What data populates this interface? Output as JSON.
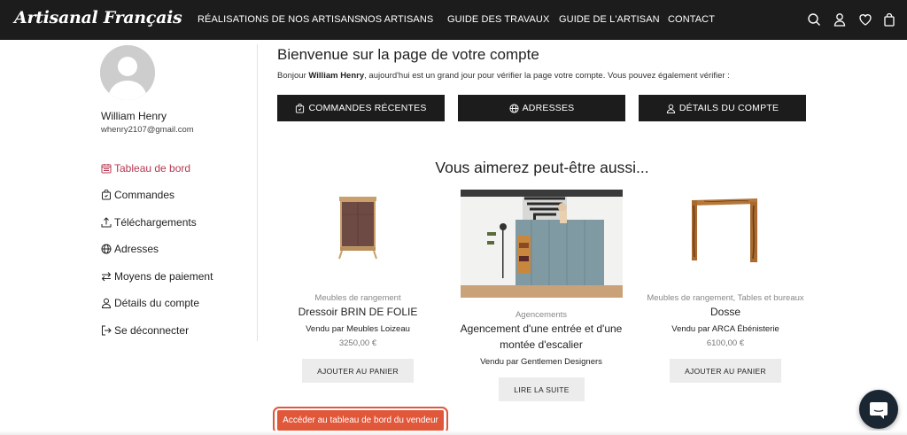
{
  "header": {
    "logo": "Artisanal Français",
    "nav": [
      {
        "label": "RÉALISATIONS DE NOS ARTISANS"
      },
      {
        "label": "NOS ARTISANS"
      },
      {
        "label": "GUIDE DES TRAVAUX"
      },
      {
        "label": "GUIDE DE L'ARTISAN"
      },
      {
        "label": "CONTACT"
      }
    ],
    "icons": [
      "search-icon",
      "user-icon",
      "heart-icon",
      "bag-icon"
    ]
  },
  "user": {
    "name": "William Henry",
    "email": "whenry2107@gmail.com"
  },
  "sidebar": {
    "active_color": "#b5374f",
    "items": [
      {
        "label": "Tableau de bord",
        "icon": "calendar-icon",
        "active": true
      },
      {
        "label": "Commandes",
        "icon": "basket-icon"
      },
      {
        "label": "Téléchargements",
        "icon": "upload-icon"
      },
      {
        "label": "Adresses",
        "icon": "globe-icon"
      },
      {
        "label": "Moyens de paiement",
        "icon": "swap-arrows-icon"
      },
      {
        "label": "Détails du compte",
        "icon": "user-icon"
      },
      {
        "label": "Se déconnecter",
        "icon": "logout-icon"
      }
    ]
  },
  "main": {
    "title": "Bienvenue sur la page de votre compte",
    "intro_before": "Bonjour ",
    "intro_name": "William Henry",
    "intro_after": ", aujourd'hui est un grand jour pour vérifier la page votre compte. Vous pouvez également vérifier :",
    "buttons": [
      {
        "label": "COMMANDES RÉCENTES",
        "icon": "basket-icon"
      },
      {
        "label": "ADRESSES",
        "icon": "globe-icon"
      },
      {
        "label": "DÉTAILS DU COMPTE",
        "icon": "user-icon"
      }
    ],
    "suggest_title": "Vous aimerez peut-être aussi...",
    "products": [
      {
        "category": "Meubles de rangement",
        "name": "Dressoir BRIN DE FOLIE",
        "vendor": "Vendu par Meubles Loizeau",
        "price": "3250,00 €",
        "button": "AJOUTER AU PANIER"
      },
      {
        "category": "Agencements",
        "name": "Agencement d'une entrée et d'une montée d'escalier",
        "vendor": "Vendu par Gentlemen Designers",
        "button": "LIRE LA SUITE"
      },
      {
        "category": "Meubles de rangement, Tables et bureaux",
        "name": "Dosse",
        "vendor": "Vendu par ARCA Ébénisterie",
        "price": "6100,00 €",
        "button": "AJOUTER AU PANIER"
      }
    ],
    "vendor_dashboard": "Accéder au tableau de bord du vendeur"
  },
  "colors": {
    "header_bg": "#1c1c1c",
    "accent": "#e0573a",
    "active_link": "#b5374f"
  }
}
